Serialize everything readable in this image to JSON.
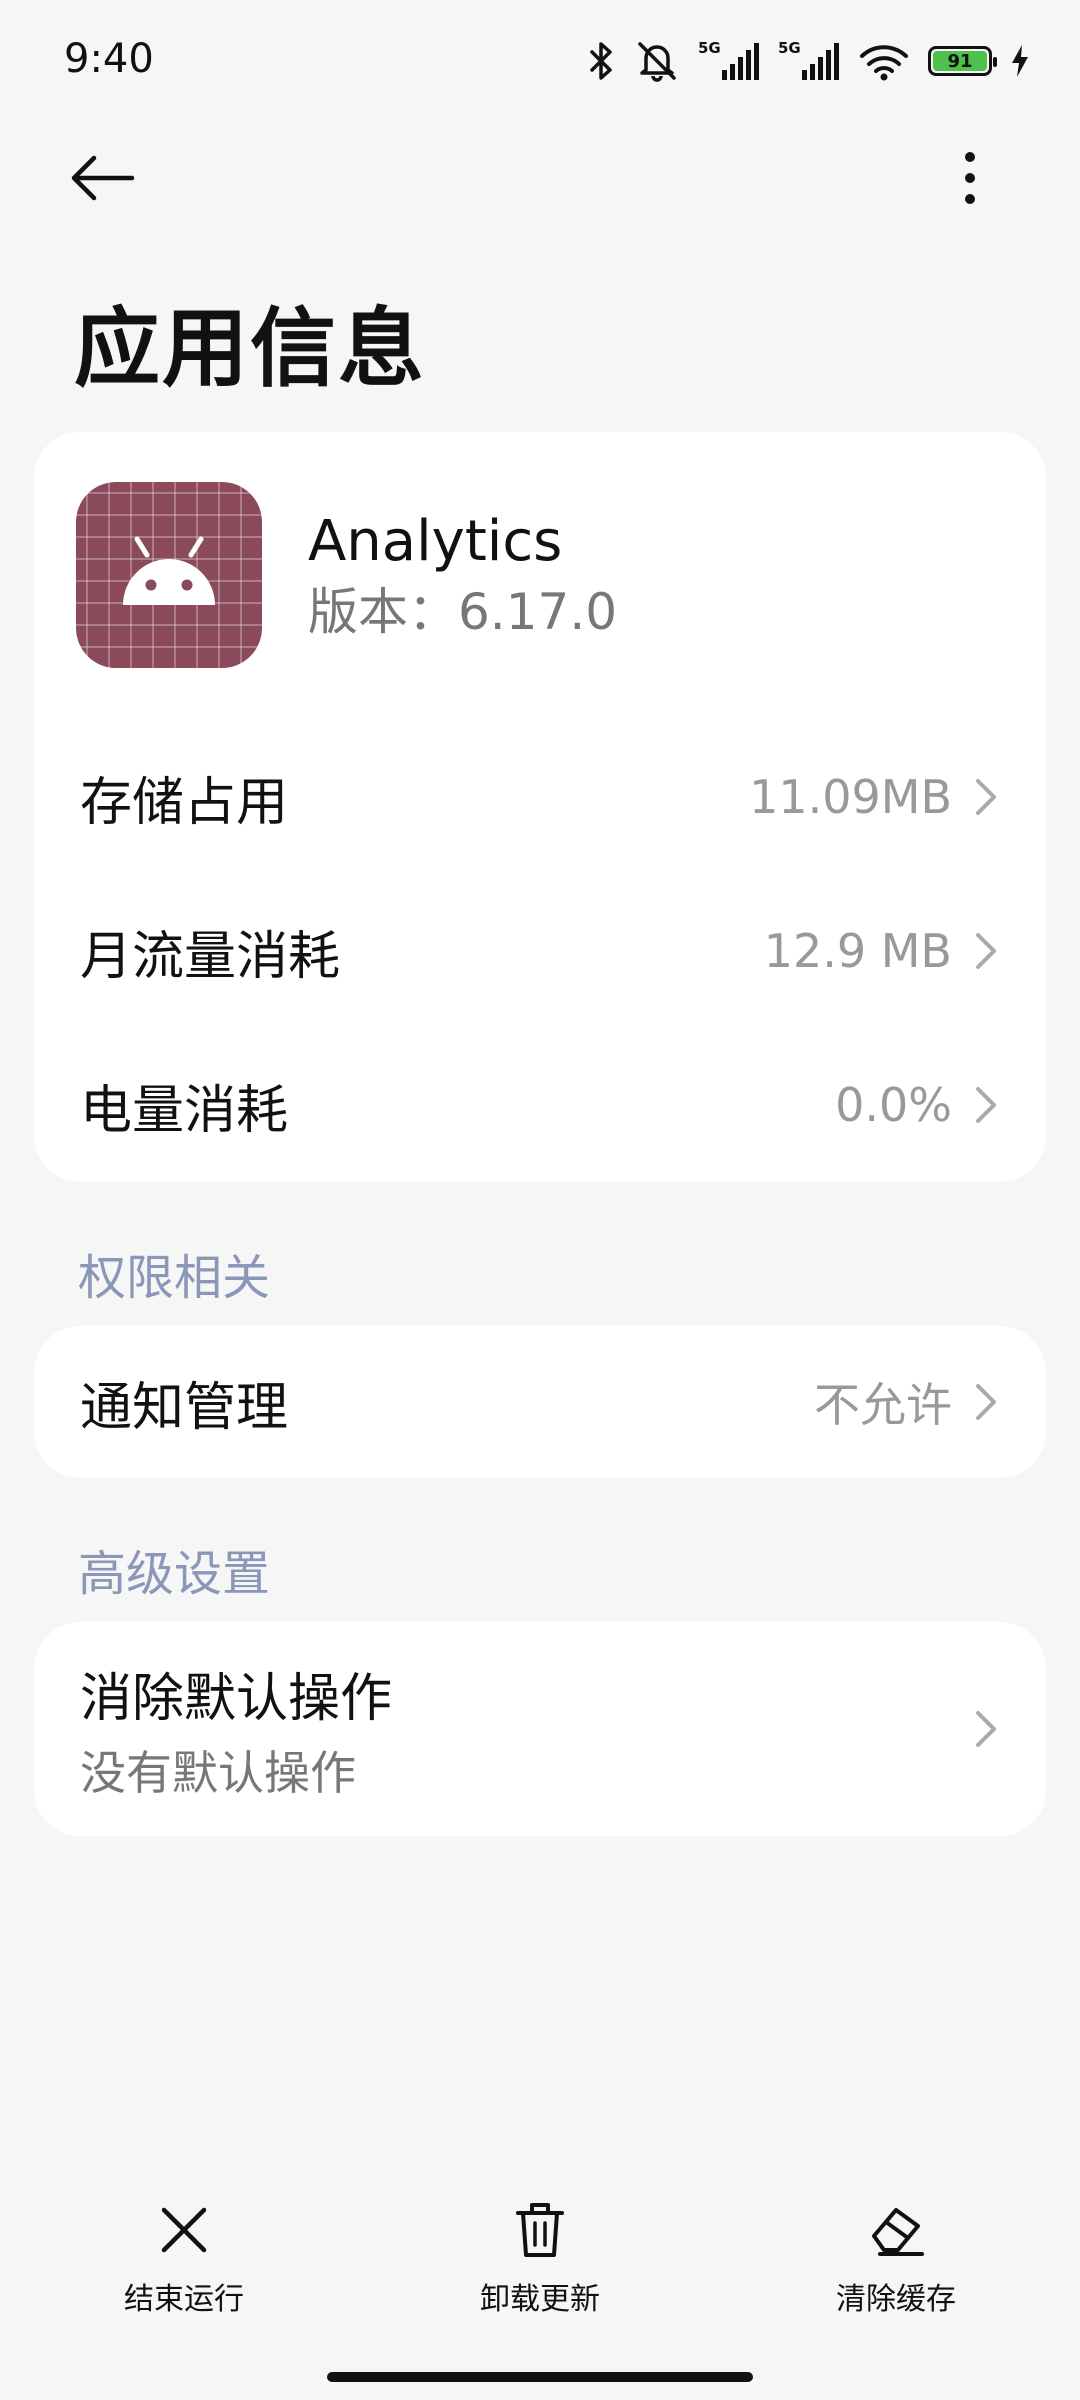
{
  "status_bar": {
    "time": "9:40",
    "network_label_1": "5G",
    "network_label_2": "5G",
    "battery_level": "91",
    "icons": [
      "bluetooth-icon",
      "mute-icon",
      "signal-icon",
      "signal-icon",
      "wifi-icon",
      "battery-icon",
      "charging-icon"
    ]
  },
  "header": {
    "title": "应用信息",
    "back_icon": "arrow-left-icon",
    "more_icon": "more-vertical-icon"
  },
  "app": {
    "name": "Analytics",
    "version": "版本：6.17.0",
    "icon": "android-icon",
    "icon_color": "#8a4a5c"
  },
  "usage_rows": [
    {
      "label": "存储占用",
      "value": "11.09MB"
    },
    {
      "label": "月流量消耗",
      "value": "12.9 MB"
    },
    {
      "label": "电量消耗",
      "value": "0.0%"
    }
  ],
  "permissions": {
    "section_title": "权限相关",
    "rows": [
      {
        "label": "通知管理",
        "value": "不允许"
      }
    ]
  },
  "advanced": {
    "section_title": "高级设置",
    "rows": [
      {
        "label": "消除默认操作",
        "subtitle": "没有默认操作"
      }
    ]
  },
  "bottom_actions": [
    {
      "label": "结束运行",
      "icon": "close-icon"
    },
    {
      "label": "卸载更新",
      "icon": "trash-icon"
    },
    {
      "label": "清除缓存",
      "icon": "eraser-icon"
    }
  ],
  "colors": {
    "background": "#f6f6f6",
    "card": "#ffffff",
    "section_title": "#8a97b8",
    "secondary_text": "#999999",
    "battery_fill": "#4cc24a"
  }
}
